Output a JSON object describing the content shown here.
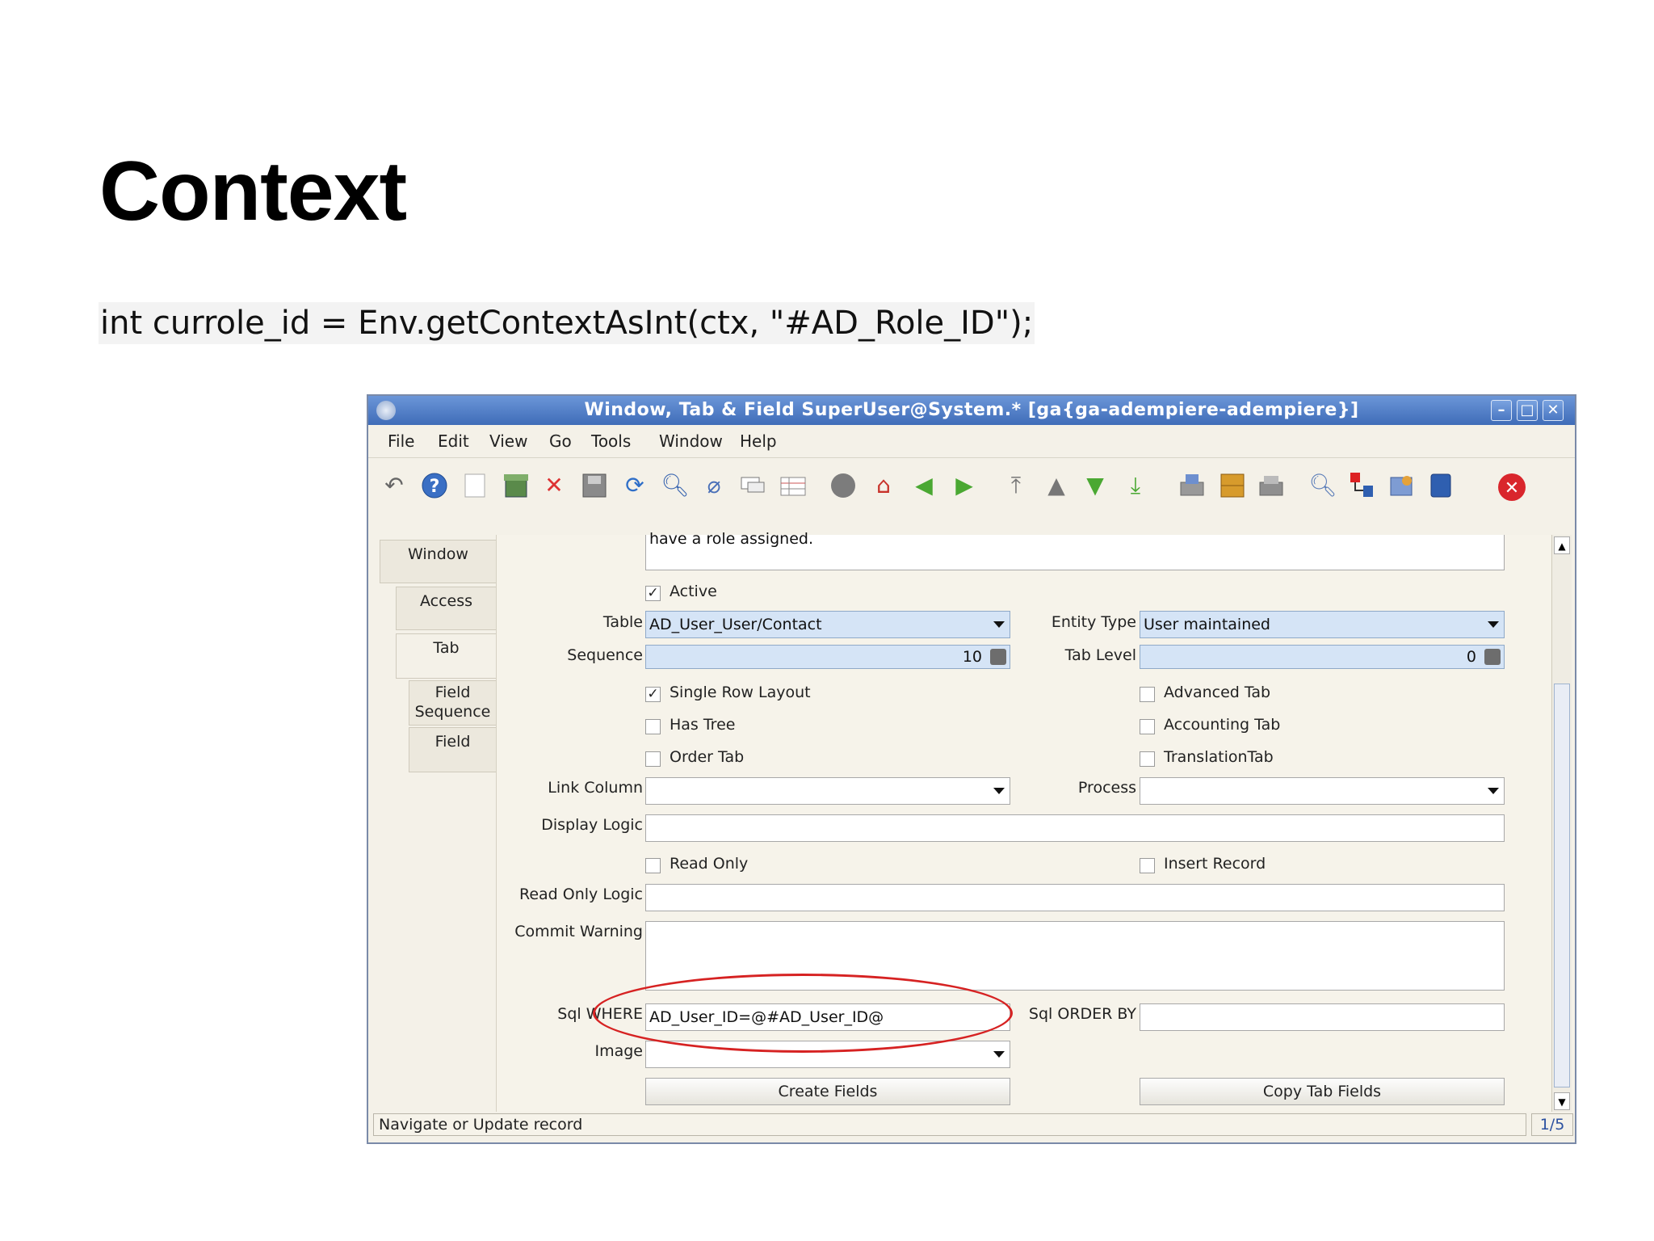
{
  "slide": {
    "title": "Context",
    "code": "int currole_id = Env.getContextAsInt(ctx, \"#AD_Role_ID\");"
  },
  "window": {
    "title": "Window, Tab & Field  SuperUser@System.* [ga{ga-adempiere-adempiere}]",
    "controls": {
      "minimize": "–",
      "maximize": "□",
      "close": "✕"
    }
  },
  "menu": [
    "File",
    "Edit",
    "View",
    "Go",
    "Tools",
    "Window",
    "Help"
  ],
  "toolbar": {
    "icons": [
      "undo-icon",
      "help-icon",
      "new-record-icon",
      "copy-record-icon",
      "delete-icon",
      "save-icon",
      "refresh-icon",
      "find-icon",
      "attachment-icon",
      "chat-icon",
      "grid-toggle-icon",
      "history-icon",
      "home-icon",
      "back-icon",
      "forward-icon",
      "first-record-icon",
      "previous-record-icon",
      "next-record-icon",
      "last-record-icon",
      "report-icon",
      "archive-icon",
      "print-icon",
      "zoom-across-icon",
      "workflow-icon",
      "request-icon",
      "product-info-icon",
      "exit-icon"
    ]
  },
  "tabs": [
    {
      "label": "Window"
    },
    {
      "label": "Access"
    },
    {
      "label": "Tab"
    },
    {
      "label": "Field Sequence"
    },
    {
      "label": "Field"
    }
  ],
  "form": {
    "description_tail": "have a role assigned.",
    "active": {
      "label": "Active",
      "checked": true
    },
    "table": {
      "label": "Table",
      "value": "AD_User_User/Contact"
    },
    "entity_type": {
      "label": "Entity Type",
      "value": "User maintained"
    },
    "sequence": {
      "label": "Sequence",
      "value": "10"
    },
    "tab_level": {
      "label": "Tab Level",
      "value": "0"
    },
    "single_row_layout": {
      "label": "Single Row Layout",
      "checked": true
    },
    "advanced_tab": {
      "label": "Advanced Tab",
      "checked": false
    },
    "has_tree": {
      "label": "Has Tree",
      "checked": false
    },
    "accounting_tab": {
      "label": "Accounting Tab",
      "checked": false
    },
    "order_tab": {
      "label": "Order Tab",
      "checked": false
    },
    "translation_tab": {
      "label": "TranslationTab",
      "checked": false
    },
    "link_column": {
      "label": "Link Column",
      "value": ""
    },
    "process": {
      "label": "Process",
      "value": ""
    },
    "display_logic": {
      "label": "Display Logic",
      "value": ""
    },
    "read_only": {
      "label": "Read Only",
      "checked": false
    },
    "insert_record": {
      "label": "Insert Record",
      "checked": false
    },
    "read_only_logic": {
      "label": "Read Only Logic",
      "value": ""
    },
    "commit_warning": {
      "label": "Commit Warning",
      "value": ""
    },
    "sql_where": {
      "label": "Sql WHERE",
      "value": "AD_User_ID=@#AD_User_ID@"
    },
    "sql_order_by": {
      "label": "Sql ORDER BY",
      "value": ""
    },
    "image": {
      "label": "Image",
      "value": ""
    },
    "create_fields_button": "Create Fields",
    "copy_tab_fields_button": "Copy Tab Fields"
  },
  "status": {
    "message": "Navigate or Update record",
    "page": "1/5"
  },
  "colors": {
    "titlebar": "#4a77c2",
    "highlight_ellipse": "#d62222",
    "field_blue": "#d5e4f6"
  }
}
